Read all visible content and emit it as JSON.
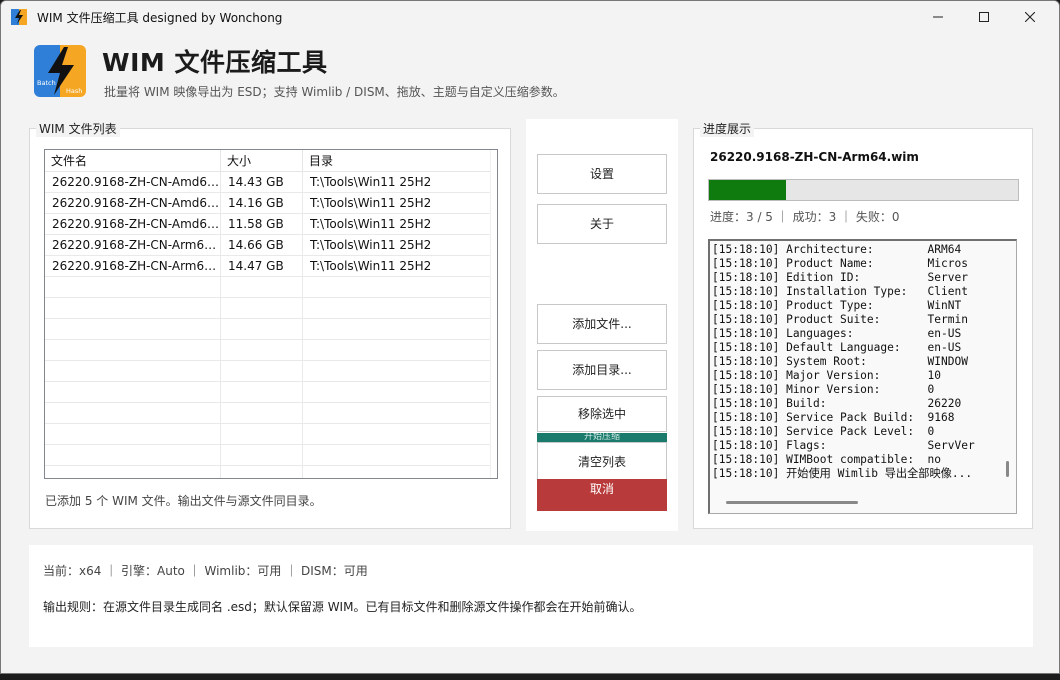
{
  "window": {
    "title": "WIM 文件压缩工具 designed by Wonchong",
    "controls": {
      "minimize": "—",
      "maximize": "☐",
      "close": "✕"
    }
  },
  "header": {
    "title": "WIM 文件压缩工具",
    "subtitle": "批量将 WIM 映像导出为 ESD；支持 Wimlib / DISM、拖放、主题与自定义压缩参数。",
    "logo": {
      "top_text": "Batch",
      "bottom_text": "Hash",
      "icon": "lightning-bolt-icon",
      "colors": {
        "left": "#2f7fd8",
        "right": "#f5a623",
        "bolt": "#111111"
      }
    }
  },
  "file_list": {
    "legend": "WIM 文件列表",
    "columns": [
      "文件名",
      "大小",
      "目录"
    ],
    "rows": [
      {
        "name": "26220.9168-ZH-CN-Amd64....",
        "size": "14.43 GB",
        "dir": "T:\\Tools\\Win11 25H2"
      },
      {
        "name": "26220.9168-ZH-CN-Amd64....",
        "size": "14.16 GB",
        "dir": "T:\\Tools\\Win11 25H2"
      },
      {
        "name": "26220.9168-ZH-CN-Amd64....",
        "size": "11.58 GB",
        "dir": "T:\\Tools\\Win11 25H2"
      },
      {
        "name": "26220.9168-ZH-CN-Arm64....",
        "size": "14.66 GB",
        "dir": "T:\\Tools\\Win11 25H2"
      },
      {
        "name": "26220.9168-ZH-CN-Arm64....",
        "size": "14.47 GB",
        "dir": "T:\\Tools\\Win11 25H2"
      }
    ],
    "status": "已添加 5 个 WIM 文件。输出文件与源文件同目录。"
  },
  "buttons": {
    "settings": "设置",
    "about": "关于",
    "add_files": "添加文件...",
    "add_dir": "添加目录...",
    "remove_selected": "移除选中",
    "start": "开始压缩",
    "clear_list": "清空列表",
    "cancel": "取消",
    "colors": {
      "start_bar": "#1a7a6c",
      "cancel": "#b93a3a"
    }
  },
  "progress": {
    "legend": "进度展示",
    "current_file": "26220.9168-ZH-CN-Arm64.wim",
    "fraction": 0.25,
    "bar_color": "#0f7b0f",
    "stats": "进度：3 / 5 ｜ 成功：3 ｜ 失败：0",
    "log": [
      "[15:18:10] Architecture:        ARM64",
      "[15:18:10] Product Name:        Micros",
      "[15:18:10] Edition ID:          Server",
      "[15:18:10] Installation Type:   Client",
      "[15:18:10] Product Type:        WinNT",
      "[15:18:10] Product Suite:       Termin",
      "[15:18:10] Languages:           en-US",
      "[15:18:10] Default Language:    en-US",
      "[15:18:10] System Root:         WINDOW",
      "[15:18:10] Major Version:       10",
      "[15:18:10] Minor Version:       0",
      "[15:18:10] Build:               26220",
      "[15:18:10] Service Pack Build:  9168",
      "[15:18:10] Service Pack Level:  0",
      "[15:18:10] Flags:               ServVer",
      "[15:18:10] WIMBoot compatible:  no",
      "[15:18:10] 开始使用 Wimlib 导出全部映像..."
    ]
  },
  "footer": {
    "status": "当前：x64 ｜ 引擎：Auto ｜ Wimlib：可用 ｜ DISM：可用",
    "rule": "输出规则：在源文件目录生成同名 .esd；默认保留源 WIM。已有目标文件和删除源文件操作都会在开始前确认。"
  }
}
